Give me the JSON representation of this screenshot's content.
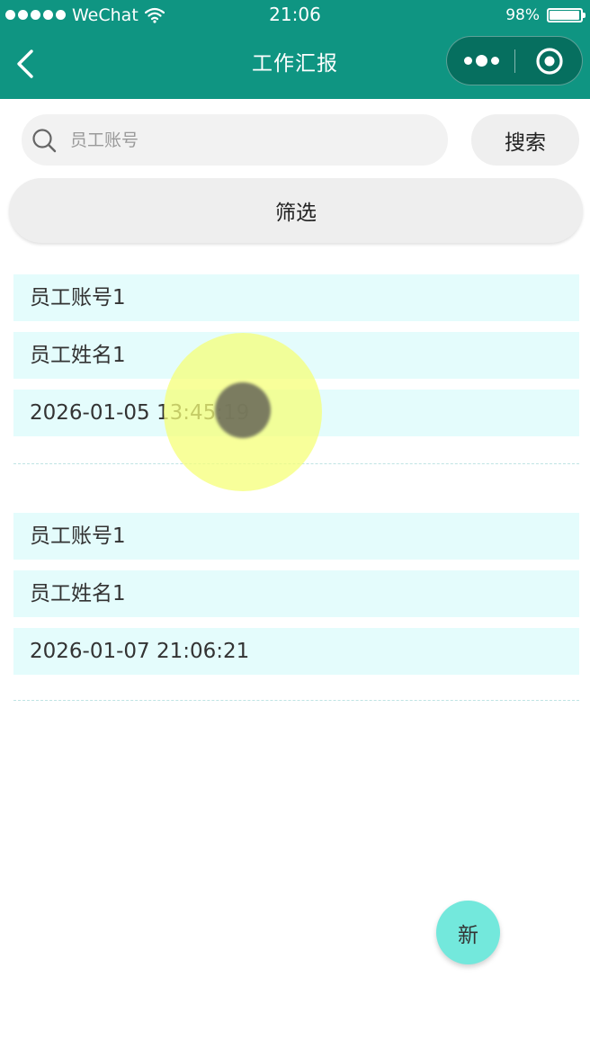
{
  "status_bar": {
    "carrier": "WeChat",
    "time": "21:06",
    "battery_text": "98%",
    "battery_level": 0.98,
    "icons": [
      "signal-icon",
      "wifi-icon",
      "battery-icon"
    ]
  },
  "nav": {
    "title": "工作汇报",
    "icons": [
      "back-icon",
      "more-icon",
      "close-mini-program-icon"
    ]
  },
  "search": {
    "placeholder": "员工账号",
    "value": "",
    "button_label": "搜索",
    "icon": "search-icon"
  },
  "filter": {
    "label": "筛选"
  },
  "reports": [
    {
      "account": "员工账号1",
      "name": "员工姓名1",
      "time": "2026-01-05 13:45:19"
    },
    {
      "account": "员工账号1",
      "name": "员工姓名1",
      "time": "2026-01-07 21:06:21"
    }
  ],
  "fab": {
    "label": "新"
  },
  "colors": {
    "primary": "#0f9582",
    "field_background": "#e4fcfc",
    "fab_background": "#73e8dc",
    "button_background": "#eeeeee"
  }
}
